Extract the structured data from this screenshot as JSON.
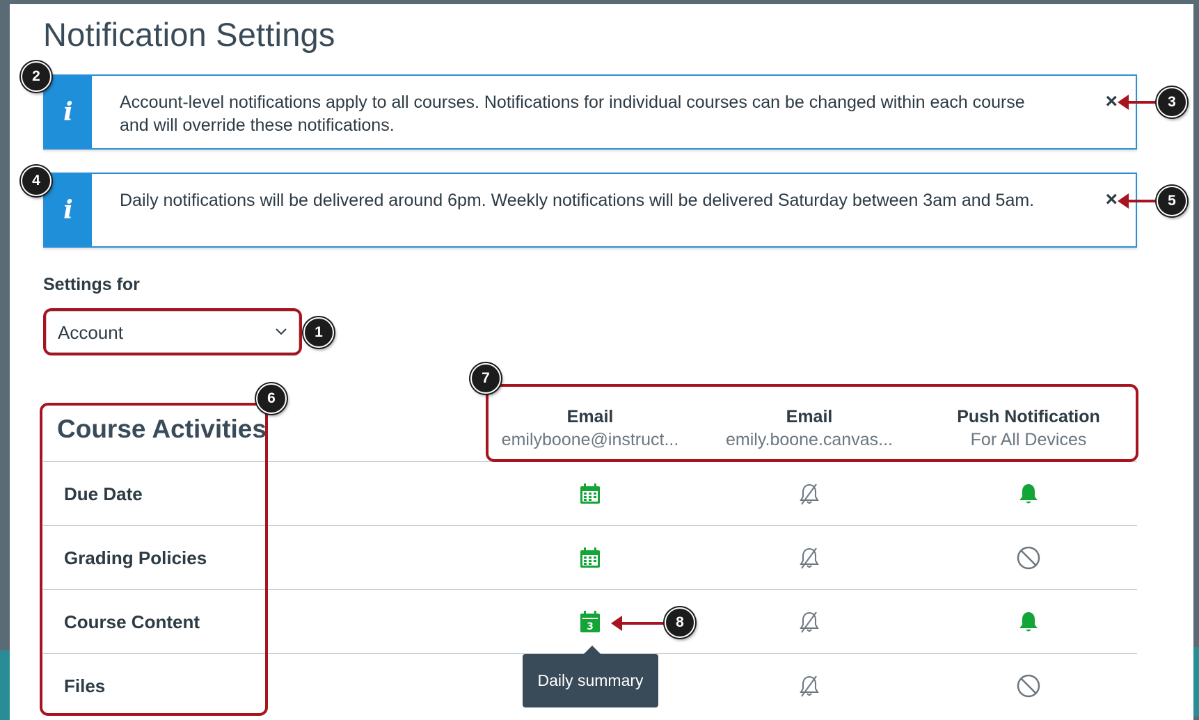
{
  "page": {
    "title": "Notification Settings"
  },
  "alerts": [
    {
      "message": "Account-level notifications apply to all courses. Notifications for individual courses can be changed within each course and will override these notifications.",
      "close": "×"
    },
    {
      "message": "Daily notifications will be delivered around 6pm. Weekly notifications will be delivered Saturday between 3am and 5am.",
      "close": "×"
    }
  ],
  "settings": {
    "label": "Settings for",
    "selected": "Account"
  },
  "table": {
    "section_title": "Course Activities",
    "columns": [
      {
        "title": "Email",
        "subtitle": "emilyboone@instruct..."
      },
      {
        "title": "Email",
        "subtitle": "emily.boone.canvas..."
      },
      {
        "title": "Push Notification",
        "subtitle": "For All Devices"
      }
    ],
    "rows": [
      {
        "label": "Due Date",
        "cells": [
          "calendar-icon",
          "bell-off-icon",
          "bell-icon"
        ]
      },
      {
        "label": "Grading Policies",
        "cells": [
          "calendar-icon",
          "bell-off-icon",
          "no-icon"
        ]
      },
      {
        "label": "Course Content",
        "cells": [
          "calendar-daily-icon",
          "bell-off-icon",
          "bell-icon"
        ]
      },
      {
        "label": "Files",
        "cells": [
          "",
          "bell-off-icon",
          "no-icon"
        ]
      }
    ],
    "daily_badge": "3"
  },
  "tooltip": {
    "text": "Daily summary"
  },
  "callouts": [
    "1",
    "2",
    "3",
    "4",
    "5",
    "6",
    "7",
    "8"
  ],
  "colors": {
    "accent": "#1f8fd9",
    "highlight": "#a7141f",
    "green": "#13a538",
    "text": "#2d3b45"
  }
}
